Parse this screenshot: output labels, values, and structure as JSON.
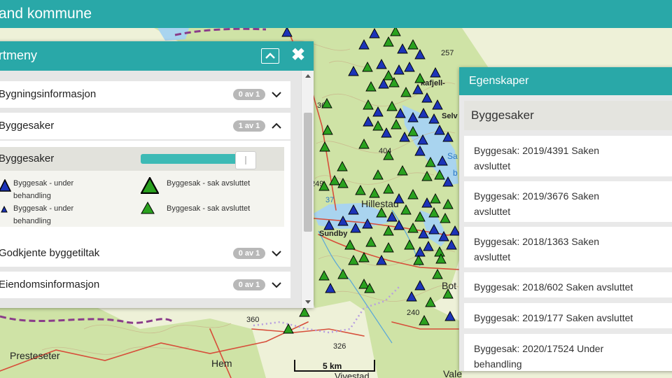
{
  "header": {
    "title": "and kommune"
  },
  "kartmeny": {
    "title": "rtmeny",
    "close_glyph": "✖",
    "categories": [
      {
        "label": "Bygningsinformasjon",
        "badge": "0 av 1"
      },
      {
        "label": "Byggesaker",
        "badge": "1 av 1"
      },
      {
        "label": "Godkjente byggetiltak",
        "badge": "0 av 1"
      },
      {
        "label": "Eiendomsinformasjon",
        "badge": "0 av 1"
      }
    ],
    "expanded_layer": {
      "label": "Byggesaker",
      "opacity_fraction": 0.9,
      "legend": [
        {
          "text": "Byggesak - under behandling",
          "symbol": "blue-triangle-large"
        },
        {
          "text": "Byggesak - sak avsluttet",
          "symbol": "green-triangle-large"
        },
        {
          "text": "Byggesak - under behandling",
          "symbol": "blue-triangle-small"
        },
        {
          "text": "Byggesak - sak avsluttet",
          "symbol": "green-triangle-small"
        }
      ]
    }
  },
  "egenskaper": {
    "title": "Egenskaper",
    "subtitle": "Byggesaker",
    "items": [
      "Byggesak: 2019/4391 Saken avsluttet",
      "Byggesak: 2019/3676 Saken avsluttet",
      "Byggesak: 2018/1363 Saken avsluttet",
      "Byggesak: 2018/602 Saken avsluttet",
      "Byggesak: 2019/177 Saken avsluttet",
      "Byggesak: 2020/17524 Under behandling"
    ]
  },
  "map": {
    "place_labels": [
      "Hillestad",
      "Sundby",
      "Presteseter",
      "Hem",
      "Bot",
      "Vale",
      "Vivestad",
      "kafjell-",
      "Selv",
      "Sa",
      "b"
    ],
    "elevation_labels": [
      "257",
      "366",
      "404",
      "249",
      "360",
      "326",
      "240",
      "37"
    ],
    "scale_bar": "5 km",
    "colors": {
      "land": "#eef1d8",
      "forest": "#cfe3a6",
      "water": "#a9d4ef",
      "road": "#d74e3a",
      "border": "#8a3c8a",
      "contour": "#c9b38a",
      "under_behandling": "#1c34b8",
      "sak_avsluttet": "#2aa11f"
    }
  },
  "colors": {
    "header": "#29a8a8",
    "slider": "#3dbab5",
    "badge": "#b8b8b8"
  }
}
